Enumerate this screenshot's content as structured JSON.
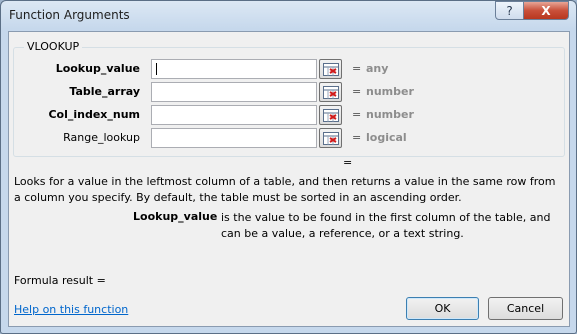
{
  "window": {
    "title": "Function Arguments",
    "help_glyph": "?",
    "close_glyph": "X"
  },
  "function_name": "VLOOKUP",
  "arguments": [
    {
      "label": "Lookup_value",
      "bold": true,
      "value": "",
      "result": "any"
    },
    {
      "label": "Table_array",
      "bold": true,
      "value": "",
      "result": "number"
    },
    {
      "label": "Col_index_num",
      "bold": true,
      "value": "",
      "result": "number"
    },
    {
      "label": "Range_lookup",
      "bold": false,
      "value": "",
      "result": "logical"
    }
  ],
  "equals_sign": "=",
  "function_result": "",
  "description": "Looks for a value in the leftmost column of a table, and then returns a value in the same row from a column you specify. By default, the table must be sorted in an ascending order.",
  "arg_help": {
    "name": "Lookup_value",
    "text": "is the value to be found in the first column of the table, and can be a value, a reference, or a text string."
  },
  "formula_result_label": "Formula result =",
  "formula_result_value": "",
  "help_link": "Help on this function",
  "buttons": {
    "ok": "OK",
    "cancel": "Cancel"
  },
  "icons": {
    "ref": "collapse-dialog-icon"
  }
}
